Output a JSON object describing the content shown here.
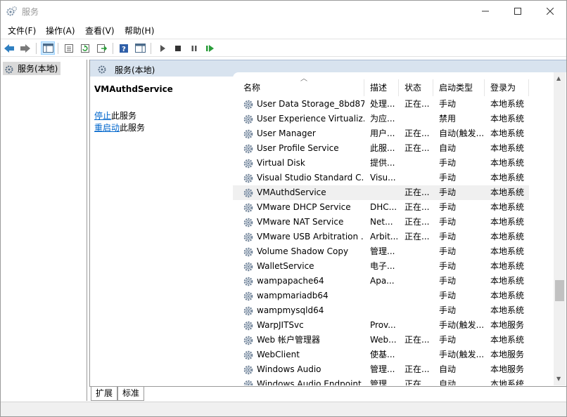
{
  "window": {
    "title": "服务"
  },
  "window_controls": {
    "minimize": "—",
    "maximize": "☐",
    "close": "✕"
  },
  "menu": [
    "文件(F)",
    "操作(A)",
    "查看(V)",
    "帮助(H)"
  ],
  "toolbar": {
    "icons": [
      "back-icon",
      "forward-icon",
      "show-hide-console-tree-icon",
      "properties-icon",
      "refresh-icon",
      "export-list-icon",
      "help-icon",
      "show-hide-action-pane-icon",
      "start-service-icon",
      "stop-service-icon",
      "pause-service-icon",
      "restart-service-icon"
    ]
  },
  "tree": {
    "root_label": "服务(本地)"
  },
  "header": {
    "title": "服务(本地)"
  },
  "extended": {
    "service_name": "VMAuthdService",
    "stop_link": "停止",
    "stop_suffix": "此服务",
    "restart_link": "重启动",
    "restart_suffix": "此服务"
  },
  "columns": [
    "名称",
    "描述",
    "状态",
    "启动类型",
    "登录为"
  ],
  "rows": [
    {
      "name": "User Data Storage_8bd87",
      "desc": "处理...",
      "status": "正在...",
      "startup": "手动",
      "logon": "本地系统"
    },
    {
      "name": "User Experience Virtualiz...",
      "desc": "为应...",
      "status": "",
      "startup": "禁用",
      "logon": "本地系统"
    },
    {
      "name": "User Manager",
      "desc": "用户...",
      "status": "正在...",
      "startup": "自动(触发...",
      "logon": "本地系统"
    },
    {
      "name": "User Profile Service",
      "desc": "此服...",
      "status": "正在...",
      "startup": "自动",
      "logon": "本地系统"
    },
    {
      "name": "Virtual Disk",
      "desc": "提供...",
      "status": "",
      "startup": "手动",
      "logon": "本地系统"
    },
    {
      "name": "Visual Studio Standard C...",
      "desc": "Visu...",
      "status": "",
      "startup": "手动",
      "logon": "本地系统"
    },
    {
      "name": "VMAuthdService",
      "desc": "",
      "status": "正在...",
      "startup": "手动",
      "logon": "本地系统",
      "selected": true
    },
    {
      "name": "VMware DHCP Service",
      "desc": "DHC...",
      "status": "正在...",
      "startup": "手动",
      "logon": "本地系统"
    },
    {
      "name": "VMware NAT Service",
      "desc": "Net...",
      "status": "正在...",
      "startup": "手动",
      "logon": "本地系统"
    },
    {
      "name": "VMware USB Arbitration ...",
      "desc": "Arbit...",
      "status": "正在...",
      "startup": "手动",
      "logon": "本地系统"
    },
    {
      "name": "Volume Shadow Copy",
      "desc": "管理...",
      "status": "",
      "startup": "手动",
      "logon": "本地系统"
    },
    {
      "name": "WalletService",
      "desc": "电子...",
      "status": "",
      "startup": "手动",
      "logon": "本地系统"
    },
    {
      "name": "wampapache64",
      "desc": "Apa...",
      "status": "",
      "startup": "手动",
      "logon": "本地系统"
    },
    {
      "name": "wampmariadb64",
      "desc": "",
      "status": "",
      "startup": "手动",
      "logon": "本地系统"
    },
    {
      "name": "wampmysqld64",
      "desc": "",
      "status": "",
      "startup": "手动",
      "logon": "本地系统"
    },
    {
      "name": "WarpJITSvc",
      "desc": "Prov...",
      "status": "",
      "startup": "手动(触发...",
      "logon": "本地服务"
    },
    {
      "name": "Web 帐户管理器",
      "desc": "Web...",
      "status": "正在...",
      "startup": "手动",
      "logon": "本地系统"
    },
    {
      "name": "WebClient",
      "desc": "使基...",
      "status": "",
      "startup": "手动(触发...",
      "logon": "本地服务"
    },
    {
      "name": "Windows Audio",
      "desc": "管理...",
      "status": "正在...",
      "startup": "自动",
      "logon": "本地服务"
    },
    {
      "name": "Windows Audio Endpoint ...",
      "desc": "管理...",
      "status": "正在...",
      "startup": "自动",
      "logon": "本地系统"
    }
  ],
  "tabs": [
    "扩展",
    "标准"
  ],
  "colors": {
    "header_strip": "#d8e3ef",
    "link": "#0066cc",
    "selected_row": "#f0f0f0",
    "tree_selected": "#d9d9d9"
  }
}
